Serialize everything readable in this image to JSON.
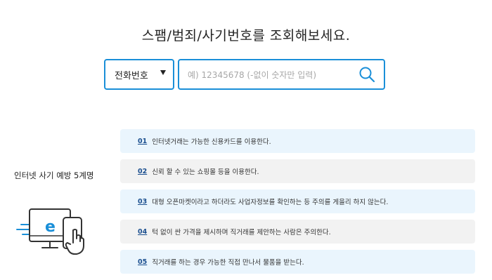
{
  "header": {
    "title": "스팸/범죄/사기번호를 조회해보세요."
  },
  "search": {
    "type_selected": "전화번호",
    "placeholder": "예) 12345678 (-없이 숫자만 입력)",
    "value": ""
  },
  "tips": {
    "title": "인터넷 사기 예방 5계명",
    "items": [
      {
        "num": "01",
        "text": "인터넷거래는 가능한 신용카드를 이용한다."
      },
      {
        "num": "02",
        "text": "신뢰 할 수 있는 쇼핑몰 등을 이용한다."
      },
      {
        "num": "03",
        "text": "대형 오픈마켓이라고 하더라도 사업자정보를 확인하는 등 주의를 게을리 하지 않는다."
      },
      {
        "num": "04",
        "text": "턱 없이 싼 가격을 제시하며 직거래를 제안하는 사람은 주의한다."
      },
      {
        "num": "05",
        "text": "직거래를 하는 경우 가능한 직접 만나서 물품을 받는다."
      }
    ]
  },
  "colors": {
    "accent": "#1a8fd8",
    "tip_blue_bg": "#eaf5fd",
    "tip_gray_bg": "#f2f2f2",
    "number": "#1b4f8f"
  },
  "icons": {
    "search": "search-icon",
    "dropdown": "caret-down-icon",
    "illustration": "computer-phone-icon"
  }
}
